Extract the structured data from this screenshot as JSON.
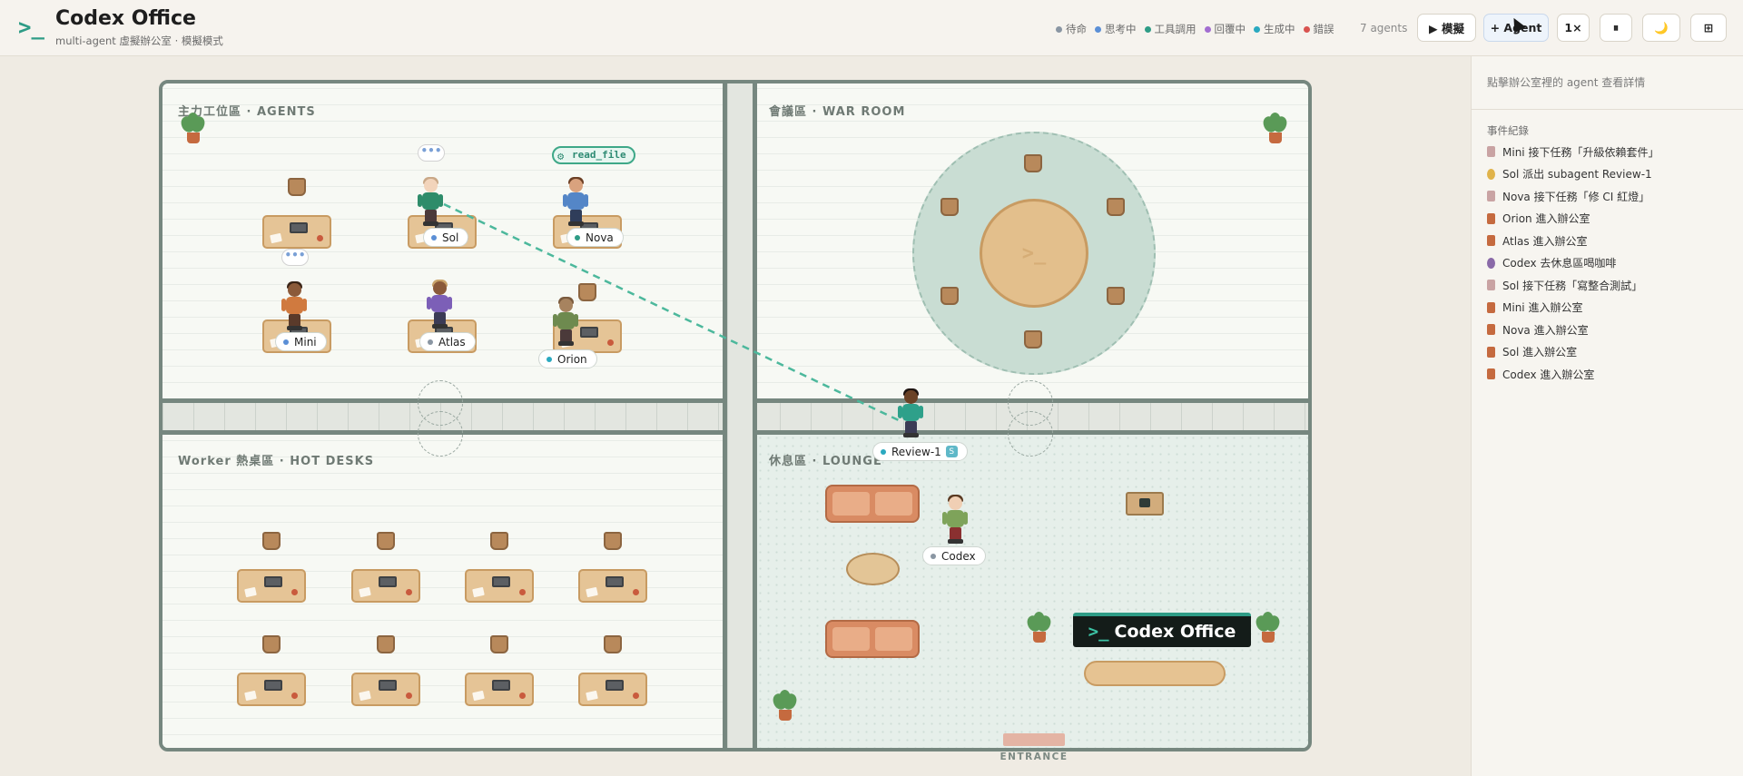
{
  "header": {
    "logo": ">_",
    "title": "Codex Office",
    "subtitle": "multi-agent 虛擬辦公室 · 模擬模式",
    "legend": [
      {
        "label": "待命",
        "color": "#8a96a3"
      },
      {
        "label": "思考中",
        "color": "#5b8fd6"
      },
      {
        "label": "工具調用",
        "color": "#2e9c86"
      },
      {
        "label": "回覆中",
        "color": "#a26dd1"
      },
      {
        "label": "生成中",
        "color": "#2aa9c0"
      },
      {
        "label": "錯誤",
        "color": "#d9534f"
      }
    ],
    "agent_count": "7 agents",
    "buttons": {
      "simulate": "▶ 模擬",
      "add_agent": "+ Agent",
      "speed": "1×",
      "pause": "⏸",
      "theme": "🌙",
      "layout": "⊞"
    }
  },
  "office": {
    "zones": {
      "agents": "主力工位區 · AGENTS",
      "war_room": "會議區 · WAR ROOM",
      "hot_desks": "Worker 熱桌區 · HOT DESKS",
      "lounge": "休息區 · LOUNGE"
    },
    "agents": [
      {
        "name": "Sol",
        "status": "thinking"
      },
      {
        "name": "Nova",
        "status": "tool"
      },
      {
        "name": "Mini",
        "status": "thinking"
      },
      {
        "name": "Atlas",
        "status": "idle"
      },
      {
        "name": "Orion",
        "status": "generating"
      },
      {
        "name": "Review-1",
        "status": "generating",
        "badge": "S"
      },
      {
        "name": "Codex",
        "status": "idle"
      }
    ],
    "speech": {
      "sol": "•••",
      "mini": "•••"
    },
    "tool_call": "read_file",
    "table_logo": ">_",
    "brand_glyph": ">_",
    "brand_name": "Codex Office",
    "entrance": "ENTRANCE"
  },
  "side": {
    "hint": "點擊辦公室裡的 agent 查看詳情",
    "log_title": "事件紀錄",
    "events": [
      {
        "text": "Mini 接下任務「升級依賴套件」",
        "color": "#c9a3a3"
      },
      {
        "text": "Sol 派出 subagent Review-1",
        "color": "#e0b34a"
      },
      {
        "text": "Nova 接下任務「修 CI 紅燈」",
        "color": "#c9a3a3"
      },
      {
        "text": "Orion 進入辦公室",
        "color": "#c56a3f"
      },
      {
        "text": "Atlas 進入辦公室",
        "color": "#c56a3f"
      },
      {
        "text": "Codex 去休息區喝咖啡",
        "color": "#8a6aa8"
      },
      {
        "text": "Sol 接下任務「寫整合測試」",
        "color": "#c9a3a3"
      },
      {
        "text": "Mini 進入辦公室",
        "color": "#c56a3f"
      },
      {
        "text": "Nova 進入辦公室",
        "color": "#c56a3f"
      },
      {
        "text": "Sol 進入辦公室",
        "color": "#c56a3f"
      },
      {
        "text": "Codex 進入辦公室",
        "color": "#c56a3f"
      }
    ]
  }
}
